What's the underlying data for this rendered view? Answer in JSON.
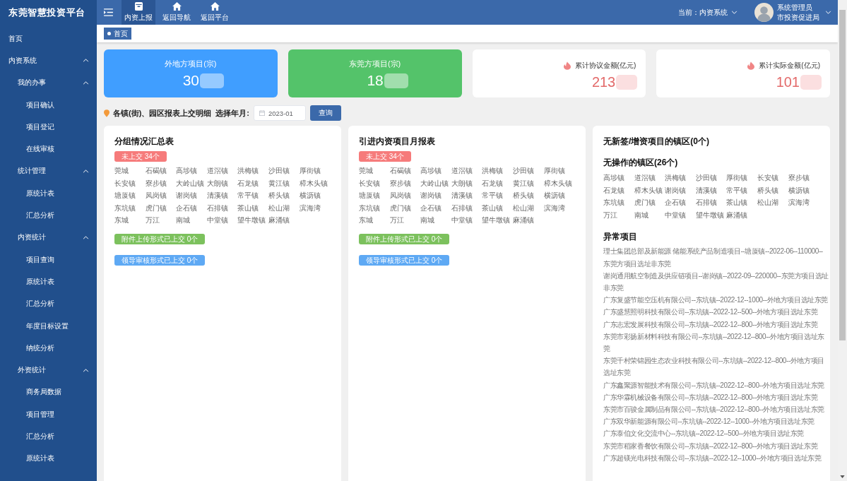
{
  "app": {
    "title": "东莞智慧投资平台"
  },
  "header": {
    "tabs": [
      {
        "label": "内资上报",
        "selected": true
      },
      {
        "label": "返回导航",
        "selected": false
      },
      {
        "label": "返回平台",
        "selected": false
      }
    ],
    "current_system": "当前：内资系统",
    "user": {
      "name": "系统管理员",
      "org": "市投资促进局"
    }
  },
  "sidebar": {
    "items": [
      {
        "label": "首页"
      },
      {
        "label": "内资系统",
        "expanded": true,
        "children": [
          {
            "label": "我的办事",
            "expanded": true,
            "children": [
              {
                "label": "项目确认"
              },
              {
                "label": "项目登记"
              },
              {
                "label": "在线审核"
              }
            ]
          },
          {
            "label": "统计管理",
            "expanded": true,
            "children": [
              {
                "label": "原统计表"
              },
              {
                "label": "汇总分析"
              }
            ]
          },
          {
            "label": "内资统计",
            "expanded": true,
            "children": [
              {
                "label": "项目查询"
              },
              {
                "label": "原统计表"
              },
              {
                "label": "汇总分析"
              },
              {
                "label": "年度目标设置"
              },
              {
                "label": "纳统分析"
              }
            ]
          },
          {
            "label": "外资统计",
            "expanded": true,
            "children": [
              {
                "label": "商务局数据"
              },
              {
                "label": "项目管理"
              },
              {
                "label": "汇总分析"
              },
              {
                "label": "原统计表"
              }
            ]
          }
        ]
      }
    ]
  },
  "breadcrumb": [
    "首页"
  ],
  "stat_cards": [
    {
      "kind": "filled",
      "color": "#409eff",
      "label": "外地方项目(宗)",
      "value": "30",
      "redacted": true
    },
    {
      "kind": "filled",
      "color": "#54c36a",
      "label": "东莞方项目(宗)",
      "value": "18",
      "redacted": true
    },
    {
      "kind": "outline",
      "label": "累计协议金额(亿元)",
      "value": "213",
      "redacted": true
    },
    {
      "kind": "outline",
      "label": "累计实际金额(亿元)",
      "value": "101",
      "redacted": true
    }
  ],
  "filter": {
    "title": "各镇(街)、园区报表上交明细",
    "date_label": "选择年月:",
    "date_value": "2023-01",
    "button": "查询"
  },
  "panels": [
    {
      "title": "分组情况汇总表",
      "blocks": [
        {
          "kind": "tag",
          "label": "未上交 34个",
          "color": "#f67b7b",
          "towns": [
            "莞城",
            "石碣镇",
            "高埗镇",
            "道滘镇",
            "洪梅镇",
            "沙田镇",
            "厚街镇",
            "长安镇",
            "寮步镇",
            "大岭山镇",
            "大朗镇",
            "石龙镇",
            "黄江镇",
            "樟木头镇",
            "塘厦镇",
            "凤岗镇",
            "谢岗镇",
            "清溪镇",
            "常平镇",
            "桥头镇",
            "横沥镇",
            "东坑镇",
            "虎门镇",
            "企石镇",
            "石排镇",
            "茶山镇",
            "松山湖",
            "滨海湾",
            "东城",
            "万江",
            "南城",
            "中堂镇",
            "望牛墩镇",
            "麻涌镇"
          ]
        },
        {
          "kind": "tag",
          "label": "附件上传形式已上交 0个",
          "color": "#7cc15d"
        },
        {
          "kind": "tag",
          "label": "领导审核形式已上交 0个",
          "color": "#5ea9f4"
        }
      ]
    },
    {
      "title": "引进内资项目月报表",
      "blocks": [
        {
          "kind": "tag",
          "label": "未上交 34个",
          "color": "#f67b7b",
          "towns": [
            "莞城",
            "石碣镇",
            "高埗镇",
            "道滘镇",
            "洪梅镇",
            "沙田镇",
            "厚街镇",
            "长安镇",
            "寮步镇",
            "大岭山镇",
            "大朗镇",
            "石龙镇",
            "黄江镇",
            "樟木头镇",
            "塘厦镇",
            "凤岗镇",
            "谢岗镇",
            "清溪镇",
            "常平镇",
            "桥头镇",
            "横沥镇",
            "东坑镇",
            "虎门镇",
            "企石镇",
            "石排镇",
            "茶山镇",
            "松山湖",
            "滨海湾",
            "东城",
            "万江",
            "南城",
            "中堂镇",
            "望牛墩镇",
            "麻涌镇"
          ]
        },
        {
          "kind": "tag",
          "label": "附件上传形式已上交 0个",
          "color": "#7cc15d"
        },
        {
          "kind": "tag",
          "label": "领导审核形式已上交 0个",
          "color": "#5ea9f4"
        }
      ]
    },
    {
      "title": "无新签/增资项目的镇区(0个)",
      "blocks": [
        {
          "kind": "heading",
          "label": "无操作的镇区(26个)",
          "towns": [
            "高埗镇",
            "道滘镇",
            "洪梅镇",
            "沙田镇",
            "厚街镇",
            "长安镇",
            "寮步镇",
            "石龙镇",
            "樟木头镇",
            "谢岗镇",
            "清溪镇",
            "常平镇",
            "桥头镇",
            "横沥镇",
            "东坑镇",
            "虎门镇",
            "企石镇",
            "石排镇",
            "茶山镇",
            "松山湖",
            "滨海湾",
            "万江",
            "南城",
            "中堂镇",
            "望牛墩镇",
            "麻涌镇"
          ]
        },
        {
          "kind": "heading",
          "label": "异常项目",
          "lines": [
            "理士集团总部及新能源 储能系统产品制造项目--塘厦镇--2022-06--110000--东莞方项目选址非东莞",
            "谢岗通用航空制造及供应链项目--谢岗镇--2022-09--220000--东莞方项目选址非东莞",
            "广东复盛节能空压机有限公司--东坑镇--2022-12--1000--外地方项目选址东莞",
            "广东盛慧照明科技有限公司--东坑镇--2022-12--500--外地方项目选址东莞",
            "广东志宏发展科技有限公司--东坑镇--2022-12--800--外地方项目选址东莞",
            "东莞市彩扬新材料科技有限公司--东坑镇--2022-12--800--外地方项目选址东莞",
            "东莞千村荣锦园生态农业科技有限公司--东坑镇--2022-12--800--外地方项目选址东莞",
            "广东鑫聚源智能技术有限公司--东坑镇--2022-12--800--外地方项目选址东莞",
            "广东华霖机械设备有限公司--东坑镇--2022-12--800--外地方项目选址东莞",
            "东莞市百骏金属制品有限公司--东坑镇--2022-12--800--外地方项目选址东莞",
            "广东双华新能源有限公司--东坑镇--2022-12--1000--外地方项目选址东莞",
            "广东泰伯文化交流中心--东坑镇--2022-12--500--外地方项目选址东莞",
            "东莞市稻家香餐饮有限公司--东坑镇--2022-12--800--外地方项目选址东莞",
            "广东超镁光电科技有限公司--东坑镇--2022-12--1000--外地方项目选址东莞"
          ]
        }
      ]
    }
  ]
}
